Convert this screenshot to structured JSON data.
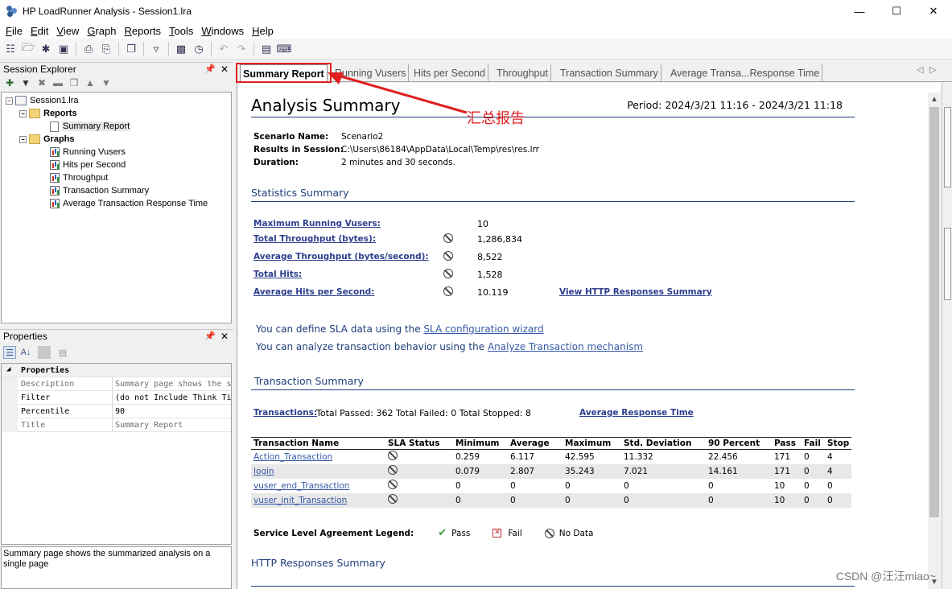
{
  "window": {
    "title": "HP LoadRunner Analysis - Session1.lra",
    "controls": [
      "—",
      "☐",
      "✕"
    ]
  },
  "menu": [
    {
      "key": "F",
      "rest": "ile"
    },
    {
      "key": "E",
      "rest": "dit"
    },
    {
      "key": "V",
      "rest": "iew"
    },
    {
      "key": "G",
      "rest": "raph"
    },
    {
      "key": "R",
      "rest": "eports"
    },
    {
      "key": "T",
      "rest": "ools"
    },
    {
      "key": "W",
      "rest": "indows"
    },
    {
      "key": "H",
      "rest": "elp"
    }
  ],
  "explorer": {
    "title": "Session Explorer",
    "session": "Session1.lra",
    "reports_label": "Reports",
    "summary_item": "Summary Report",
    "graphs_label": "Graphs",
    "graphs": [
      "Running Vusers",
      "Hits per Second",
      "Throughput",
      "Transaction Summary",
      "Average Transaction Response Time"
    ]
  },
  "properties": {
    "title": "Properties",
    "category": "Properties",
    "rows": [
      {
        "key": "Description",
        "value": "Summary page shows the s",
        "gray": true
      },
      {
        "key": "Filter",
        "value": "(do not Include Think Ti",
        "gray": false
      },
      {
        "key": "Percentile",
        "value": "90",
        "gray": false
      },
      {
        "key": "Title",
        "value": "Summary Report",
        "gray": true
      }
    ],
    "description": "Summary page shows the summarized analysis on a single page"
  },
  "tabs": [
    "Summary Report",
    "Running Vusers",
    "Hits per Second",
    "Throughput",
    "Transaction Summary",
    "Average Transa...Response Time"
  ],
  "annotation": "汇总报告",
  "report": {
    "title": "Analysis Summary",
    "period": "Period: 2024/3/21 11:16 - 2024/3/21 11:18",
    "scenario_label": "Scenario Name:",
    "scenario_value": "Scenario2",
    "results_label": "Results in Session:",
    "results_value": "C:\\Users\\86184\\AppData\\Local\\Temp\\res\\res.lrr",
    "duration_label": "Duration:",
    "duration_value": "2 minutes and 30 seconds.",
    "stats_title": "Statistics Summary",
    "stats": [
      {
        "label": "Maximum Running Vusers:",
        "value": "10",
        "nodata": false
      },
      {
        "label": "Total Throughput (bytes):",
        "value": "1,286,834",
        "nodata": true
      },
      {
        "label": "Average Throughput (bytes/second):",
        "value": "8,522",
        "nodata": true
      },
      {
        "label": "Total Hits:",
        "value": "1,528",
        "nodata": true
      },
      {
        "label": "Average Hits per Second:",
        "value": "10.119",
        "nodata": true
      }
    ],
    "http_link": "View HTTP Responses Summary",
    "sla_pre": "You can define SLA data using the ",
    "sla_link": "SLA configuration wizard",
    "analyze_pre": "You can analyze transaction behavior using the ",
    "analyze_link": "Analyze Transaction mechanism",
    "tx_title": "Transaction Summary",
    "tx_label": "Transactions:",
    "tx_totals": " Total Passed: 362 Total Failed: 0 Total Stopped: 8",
    "avg_rt_link": "Average Response Time",
    "columns": [
      "Transaction Name",
      "SLA Status",
      "Minimum",
      "Average",
      "Maximum",
      "Std. Deviation",
      "90 Percent",
      "Pass",
      "Fail",
      "Stop"
    ],
    "rows": [
      {
        "name": "Action_Transaction",
        "min": "0.259",
        "avg": "6.117",
        "max": "42.595",
        "std": "11.332",
        "p90": "22.456",
        "pass": "171",
        "fail": "0",
        "stop": "4"
      },
      {
        "name": "login",
        "min": "0.079",
        "avg": "2.807",
        "max": "35.243",
        "std": "7.021",
        "p90": "14.161",
        "pass": "171",
        "fail": "0",
        "stop": "4"
      },
      {
        "name": "vuser_end_Transaction",
        "min": "0",
        "avg": "0",
        "max": "0",
        "std": "0",
        "p90": "0",
        "pass": "10",
        "fail": "0",
        "stop": "0"
      },
      {
        "name": "vuser_init_Transaction",
        "min": "0",
        "avg": "0",
        "max": "0",
        "std": "0",
        "p90": "0",
        "pass": "10",
        "fail": "0",
        "stop": "0"
      }
    ],
    "legend_label": "Service Level Agreement Legend:",
    "legend_pass": "Pass",
    "legend_fail": "Fail",
    "legend_nodata": "No Data",
    "http_title": "HTTP Responses Summary"
  },
  "watermark": "CSDN @汪汪miao~"
}
